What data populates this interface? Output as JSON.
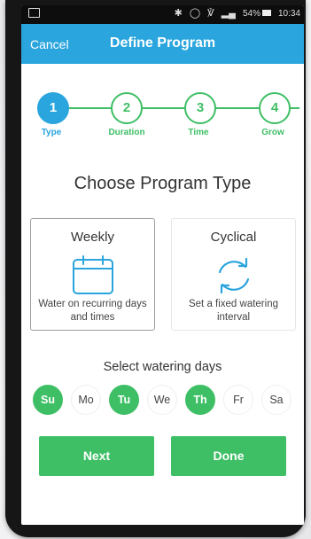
{
  "status_bar": {
    "bluetooth_icon": "bluetooth-icon",
    "alarm_icon": "alarm-icon",
    "wifi_icon": "wifi-icon",
    "signal_icon": "signal-icon",
    "battery": "54%",
    "time": "10:34"
  },
  "header": {
    "cancel_label": "Cancel",
    "title": "Define Program",
    "background_color": "#2aa5dd"
  },
  "steps": [
    {
      "number": "1",
      "label": "Type",
      "active": true
    },
    {
      "number": "2",
      "label": "Duration",
      "active": false
    },
    {
      "number": "3",
      "label": "Time",
      "active": false
    },
    {
      "number": "4",
      "label": "Grow",
      "active": false
    }
  ],
  "main": {
    "heading": "Choose Program Type",
    "program_types": [
      {
        "title": "Weekly",
        "description": "Water on recurring days and times",
        "icon": "calendar-icon",
        "selected": true
      },
      {
        "title": "Cyclical",
        "description": "Set a fixed watering interval",
        "icon": "cycle-arrows-icon",
        "selected": false
      }
    ],
    "days_heading": "Select watering days",
    "days": [
      {
        "label": "Su",
        "selected": true
      },
      {
        "label": "Mo",
        "selected": false
      },
      {
        "label": "Tu",
        "selected": true
      },
      {
        "label": "We",
        "selected": false
      },
      {
        "label": "Th",
        "selected": true
      },
      {
        "label": "Fr",
        "selected": false
      },
      {
        "label": "Sa",
        "selected": false
      }
    ]
  },
  "actions": {
    "next_label": "Next",
    "done_label": "Done"
  },
  "colors": {
    "accent_blue": "#2aa5dd",
    "accent_green": "#3fbf65"
  }
}
